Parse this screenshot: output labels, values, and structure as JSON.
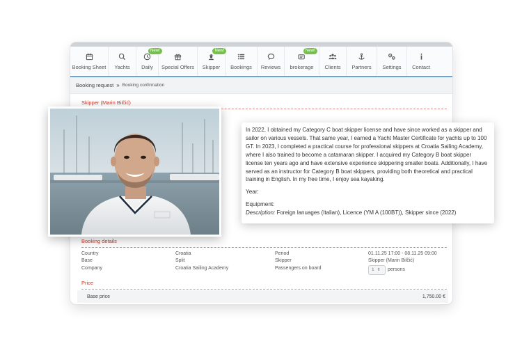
{
  "nav": {
    "items": [
      {
        "label": "Booking Sheet",
        "icon": "calendar-icon",
        "badge": ""
      },
      {
        "label": "Yachts",
        "icon": "search-icon",
        "badge": ""
      },
      {
        "label": "Daily",
        "icon": "clock-icon",
        "badge": "New!"
      },
      {
        "label": "Special Offers",
        "icon": "gift-icon",
        "badge": ""
      },
      {
        "label": "Skipper",
        "icon": "captain-icon",
        "badge": "New!"
      },
      {
        "label": "Bookings",
        "icon": "list-icon",
        "badge": ""
      },
      {
        "label": "Reviews",
        "icon": "speech-bubble-icon",
        "badge": ""
      },
      {
        "label": "brokerage",
        "icon": "tag-icon",
        "badge": "New!"
      },
      {
        "label": "Clients",
        "icon": "users-icon",
        "badge": ""
      },
      {
        "label": "Partners",
        "icon": "anchor-icon",
        "badge": ""
      },
      {
        "label": "Settings",
        "icon": "gears-icon",
        "badge": ""
      },
      {
        "label": "Contact",
        "icon": "info-icon",
        "badge": ""
      }
    ]
  },
  "breadcrumb": {
    "first": "Booking request",
    "separator": "»",
    "current": "Booking confirmation"
  },
  "skipper_heading": "Skipper (Marin Bilčić)",
  "bio": {
    "text": "In 2022, I obtained my Category C boat skipper license and have since worked as a skipper and sailor on various vessels. That same year, I earned a Yacht Master Certificate for yachts up to 100 GT. In 2023, I completed a practical course for professional skippers at Croatia Sailing Academy, where I also trained to become a catamaran skipper. I acquired my Category B boat skipper license ten years ago and have extensive experience skippering smaller boats. Additionally, I have served as an instructor for Category B boat skippers, providing both theoretical and practical training in English. In my free time, I enjoy sea kayaking.",
    "year_label": "Year:",
    "equipment_label": "Equipment:",
    "description_label": "Description:",
    "description_value": " Foreign lanuages (Italian), Licence (YM A (100BT)), Skipper since (2022)"
  },
  "booking_details": {
    "title": "Booking details",
    "country_label": "Country",
    "country_value": "Croatia",
    "base_label": "Base",
    "base_value": "Split",
    "company_label": "Company",
    "company_value": "Croatia Sailing Academy",
    "period_label": "Period",
    "period_value": "01.11.25 17:00 - 08.11.25 09:00",
    "skipper_label": "Skipper",
    "skipper_value": "Skipper (Marin Bilčić)",
    "passengers_label": "Passengers on board",
    "passengers_value": "1",
    "passengers_unit": "persons"
  },
  "price": {
    "title": "Price",
    "base_price_label": "Base price",
    "base_price_value": "1,750.00 €"
  },
  "colors": {
    "accent_red": "#c0392b",
    "badge_green": "#76bf4e",
    "nav_underline": "#6aa4d8"
  }
}
